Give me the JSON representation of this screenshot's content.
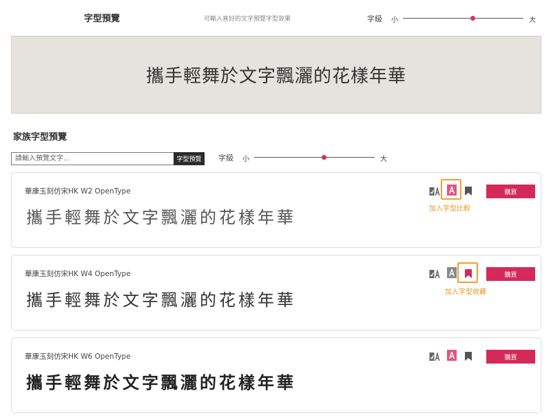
{
  "header": {
    "title": "字型預覽",
    "hint": "可輸入喜好的文字預覽字型效果",
    "size_label": "字級",
    "size_small": "小",
    "size_large": "大",
    "size_level": 0.57
  },
  "preview": {
    "text": "攜手輕舞於文字飄灑的花樣年華"
  },
  "family": {
    "title": "家族字型預覽",
    "input_value": "",
    "input_placeholder": "請輸入預覽文字...",
    "button_label": "字型預覽",
    "size_label": "字級",
    "size_small": "小",
    "size_large": "大",
    "size_level": 0.57
  },
  "fonts": [
    {
      "name": "華康玉刻仿宋HK W2 OpenType",
      "sample": "攜手輕舞於文字飄灑的花樣年華",
      "buy_label": "購買",
      "tooltip": "加入字型比較"
    },
    {
      "name": "華康玉刻仿宋HK W4 OpenType",
      "sample": "攜手輕舞於文字飄灑的花樣年華",
      "buy_label": "購買",
      "tooltip": "加入字型收藏"
    },
    {
      "name": "華康玉刻仿宋HK W6 OpenType",
      "sample": "攜手輕舞於文字飄灑的花樣年華",
      "buy_label": "購買"
    }
  ],
  "colors": {
    "accent": "#d42a5a",
    "highlight": "#f0a030",
    "hero_bg": "#e6e2dd"
  }
}
